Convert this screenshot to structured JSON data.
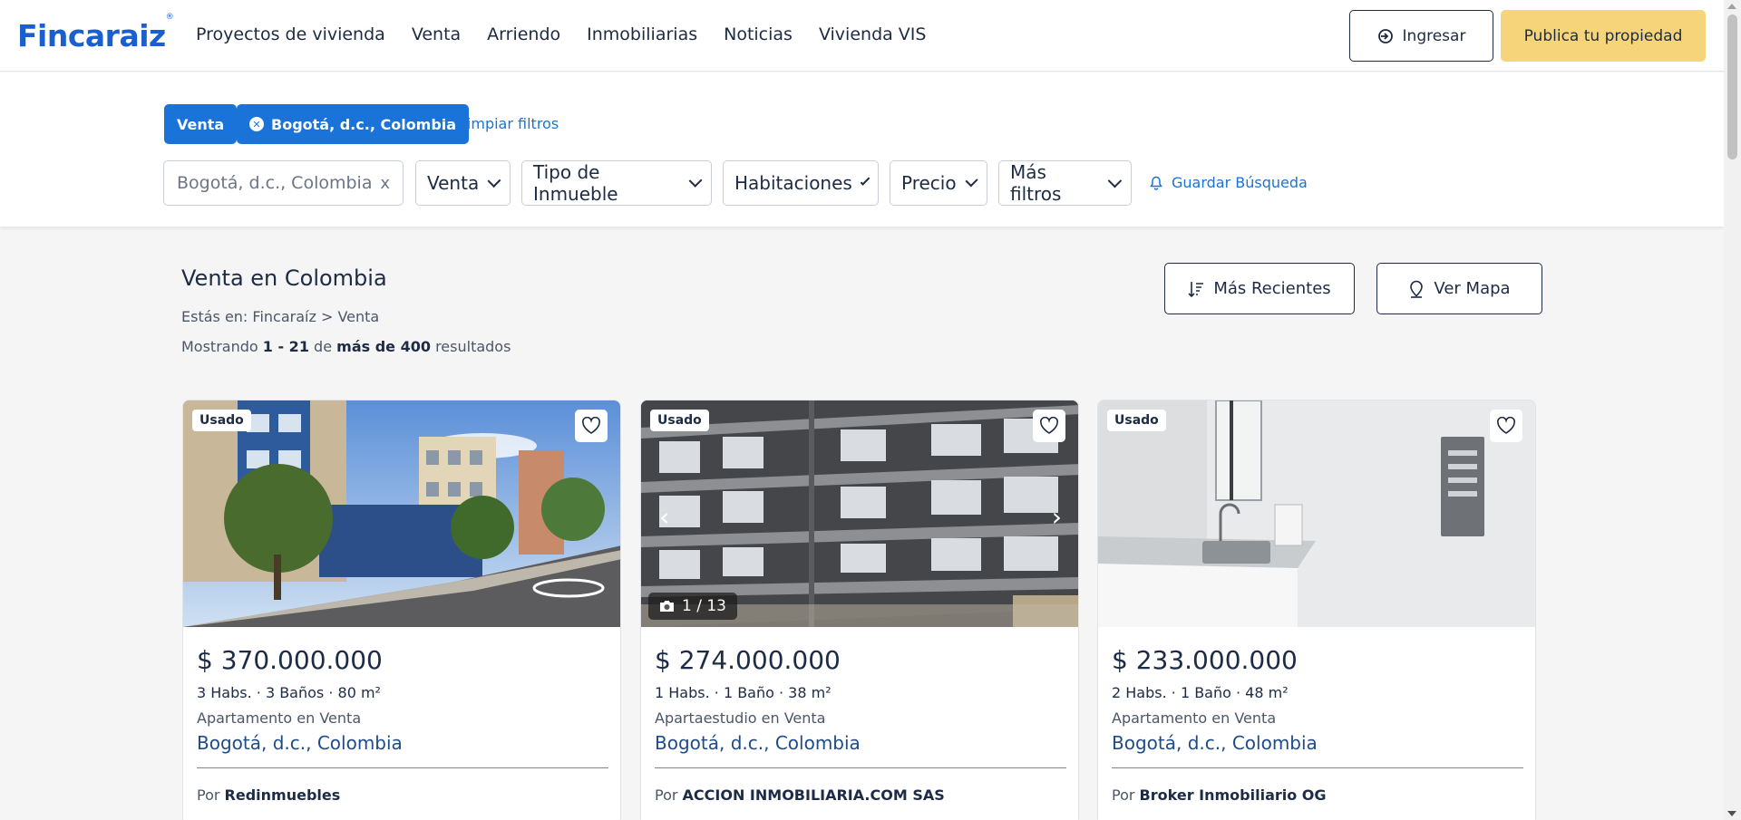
{
  "header": {
    "logo": "Fincaraiz",
    "nav": [
      "Proyectos de vivienda",
      "Venta",
      "Arriendo",
      "Inmobiliarias",
      "Noticias",
      "Vivienda VIS"
    ],
    "login_label": "Ingresar",
    "publish_label": "Publica tu propiedad"
  },
  "filters": {
    "chips": [
      "Venta",
      "Bogotá, d.c., Colombia"
    ],
    "clear_label": "Limpiar filtros",
    "location_value": "Bogotá, d.c., Colombia",
    "location_clear": "x",
    "dropdowns": [
      "Venta",
      "Tipo de Inmueble",
      "Habitaciones",
      "Precio",
      "Más filtros"
    ],
    "save_search_label": "Guardar Búsqueda"
  },
  "results": {
    "title": "Venta en Colombia",
    "breadcrumb_prefix": "Estás en:",
    "breadcrumb": "Fincaraíz > Venta",
    "count_prefix": "Mostrando",
    "count_range": "1 - 21",
    "count_mid": "de",
    "count_total": "más de 400",
    "count_suffix": "resultados",
    "sort_label": "Más Recientes",
    "map_label": "Ver Mapa"
  },
  "cards": [
    {
      "tag": "Usado",
      "price": "$ 370.000.000",
      "features": "3 Habs.  · 3 Baños · 80 m²",
      "type": "Apartamento en Venta",
      "location": "Bogotá, d.c., Colombia",
      "agent_prefix": "Por",
      "agent": "Redinmuebles"
    },
    {
      "tag": "Usado",
      "price": "$ 274.000.000",
      "features": "1 Habs.  · 1 Baño · 38 m²",
      "type": "Apartaestudio en Venta",
      "location": "Bogotá, d.c., Colombia",
      "agent_prefix": "Por",
      "agent": "ACCION INMOBILIARIA.COM SAS",
      "photo_count": "1 / 13"
    },
    {
      "tag": "Usado",
      "price": "$ 233.000.000",
      "features": "2 Habs.  · 1 Baño · 48 m²",
      "type": "Apartamento en Venta",
      "location": "Bogotá, d.c., Colombia",
      "agent_prefix": "Por",
      "agent": "Broker Inmobiliario OG"
    }
  ],
  "colors": {
    "brand_blue": "#1a73d9",
    "publish_yellow": "#f6d57a",
    "text_dark": "#1d2b44"
  }
}
